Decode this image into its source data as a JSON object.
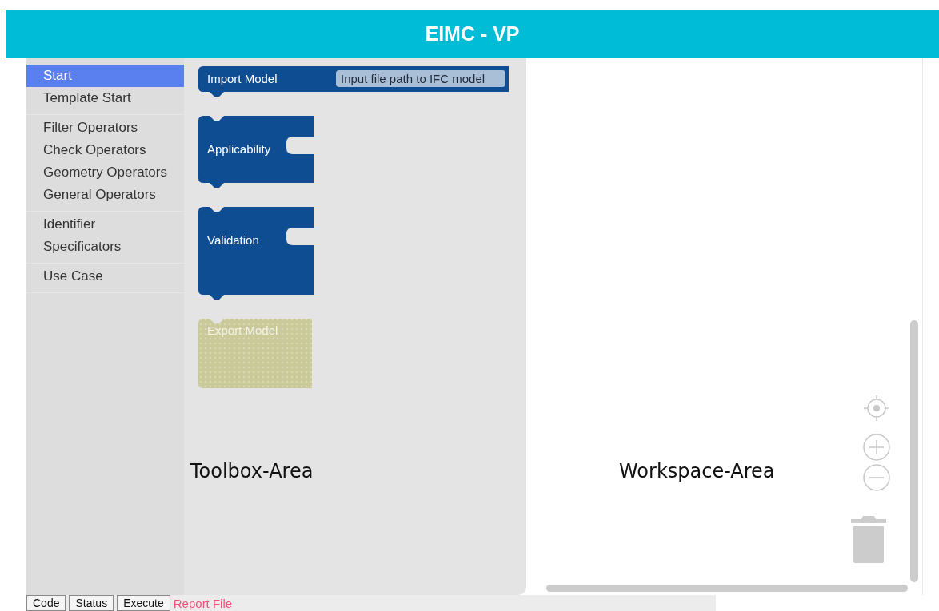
{
  "header": {
    "title": "EIMC - VP"
  },
  "sidebar": {
    "groups": [
      {
        "items": [
          {
            "label": "Start",
            "selected": true
          },
          {
            "label": "Template Start",
            "selected": false
          }
        ]
      },
      {
        "items": [
          {
            "label": "Filter Operators",
            "selected": false
          },
          {
            "label": "Check Operators",
            "selected": false
          },
          {
            "label": "Geometry Operators",
            "selected": false
          },
          {
            "label": "General Operators",
            "selected": false
          }
        ]
      },
      {
        "items": [
          {
            "label": "Identifier",
            "selected": false
          },
          {
            "label": "Specificators",
            "selected": false
          }
        ]
      },
      {
        "items": [
          {
            "label": "Use Case",
            "selected": false
          }
        ]
      }
    ]
  },
  "toolbox": {
    "blocks": [
      {
        "label": "Import Model",
        "kind": "field",
        "field_value": "Input file path to IFC model",
        "disabled": false
      },
      {
        "label": "Applicability",
        "kind": "container",
        "disabled": false
      },
      {
        "label": "Validation",
        "kind": "container",
        "disabled": false
      },
      {
        "label": "Export Model",
        "kind": "plain",
        "disabled": true
      }
    ],
    "annotation": "Toolbox-Area"
  },
  "workspace": {
    "annotation": "Workspace-Area"
  },
  "footer": {
    "buttons": [
      "Code",
      "Status",
      "Execute"
    ],
    "link": "Report File"
  }
}
